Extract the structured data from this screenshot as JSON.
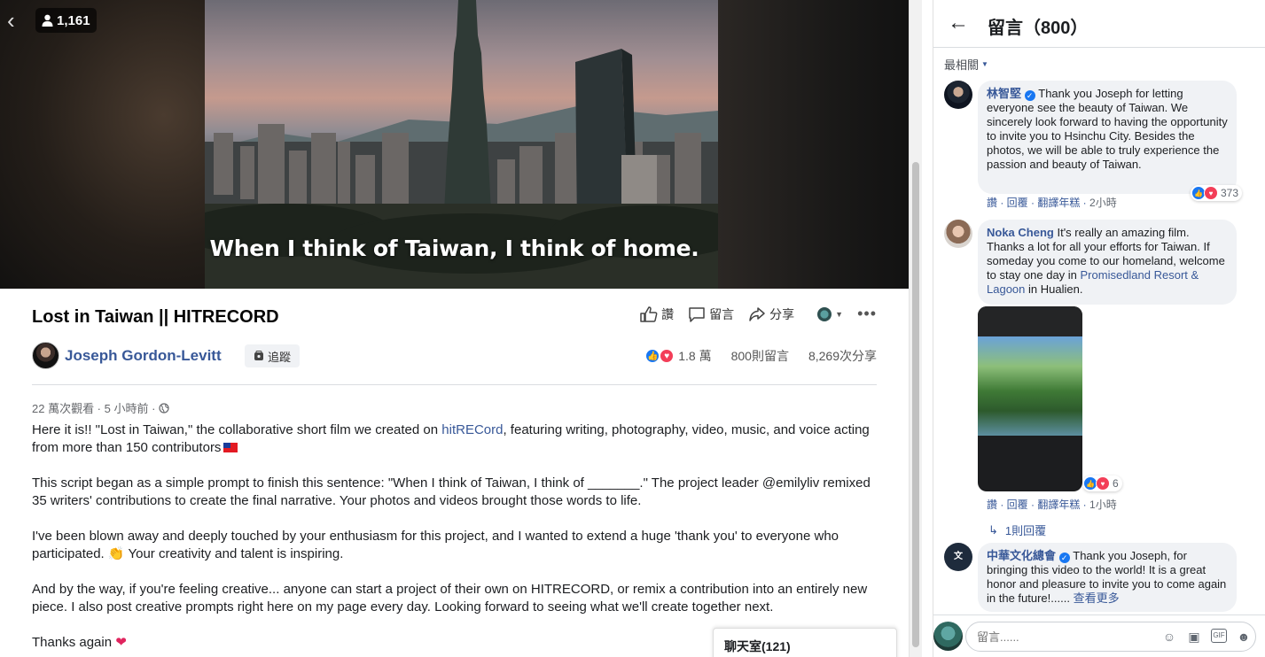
{
  "video": {
    "viewer_count": "1,161",
    "caption": "When I think of Taiwan, I think of home."
  },
  "post": {
    "title": "Lost in Taiwan || HITRECORD",
    "actions": {
      "like": "讚",
      "comment": "留言",
      "share": "分享"
    },
    "author": "Joseph Gordon-Levitt",
    "follow_label": "追蹤",
    "reactions_count": "1.8 萬",
    "comments_count": "800則留言",
    "shares_count": "8,269次分享",
    "views_meta": "22 萬次觀看 · 5 小時前 ·",
    "description": {
      "p1_a": "Here it is!! \"Lost in Taiwan,\" the collaborative short film we created on ",
      "p1_link": "hitRECord",
      "p1_b": ", featuring writing, photography, video, music, and voice acting from more than 150 contributors",
      "p2": "This script began as a simple prompt to finish this sentence: \"When I think of Taiwan, I think of _______.\" The project leader @emilyliv remixed 35 writers' contributions to create the final narrative. Your photos and videos brought those words to life.",
      "p3_a": "I've been blown away and deeply touched by your enthusiasm for this project, and I wanted to extend a huge 'thank you' to everyone who participated. ",
      "p3_emoji": "👏",
      "p3_b": " Your creativity and talent is inspiring.",
      "p4": "And by the way, if you're feeling creative... anyone can start a project of their own on HITRECORD, or remix a contribution into an entirely new piece. I also post creative prompts right here on my page every day. Looking forward to seeing what we'll create together next.",
      "p5": "Thanks again",
      "p5_emoji": "❤"
    }
  },
  "chat": {
    "title": "聊天室(121)"
  },
  "comments_panel": {
    "title": "留言（800）",
    "sort_label": "最相關",
    "comments": [
      {
        "name": "林智堅",
        "text": "Thank you Joseph for letting everyone see the beauty of Taiwan. We sincerely look forward to having the opportunity to invite you to Hsinchu City. Besides the photos, we will be able to truly experience the passion and beauty of Taiwan.",
        "reactions": "373",
        "actions": "讚 · 回覆 · 翻譯年糕 ·",
        "time": "2小時"
      },
      {
        "name": "Noka Cheng",
        "text_a": "It's really an amazing film. Thanks a lot for all your efforts for Taiwan. If someday you come to our homeland, welcome to stay one day in ",
        "link": "Promisedland Resort & Lagoon",
        "text_b": " in Hualien.",
        "reactions": "6",
        "actions": "讚 · 回覆 · 翻譯年糕 ·",
        "time": "1小時",
        "replies": "1則回覆"
      },
      {
        "name": "中華文化總會",
        "text": "Thank you Joseph, for bringing this video to the world! It is a great honor and pleasure to invite you to come again in the future!......",
        "see_more": "查看更多"
      }
    ],
    "composer_placeholder": "留言......"
  }
}
